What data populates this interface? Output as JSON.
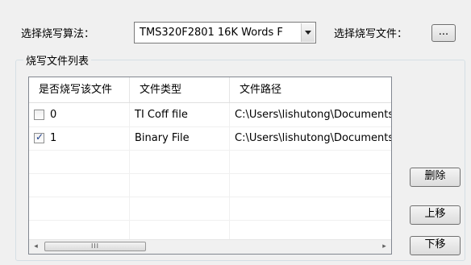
{
  "algorithm": {
    "label": "选择烧写算法：",
    "selected": "TMS320F2801 16K Words F"
  },
  "file_select": {
    "label": "选择烧写文件：",
    "browse_label": "..."
  },
  "group": {
    "title": "烧写文件列表"
  },
  "table": {
    "columns": [
      "是否烧写该文件",
      "文件类型",
      "文件路径"
    ],
    "rows": [
      {
        "checked": false,
        "index": "0",
        "type": "TI Coff file",
        "path": "C:\\Users\\lishutong\\Documents"
      },
      {
        "checked": true,
        "index": "1",
        "type": "Binary File",
        "path": "C:\\Users\\lishutong\\Documents"
      }
    ]
  },
  "scrollbar": {
    "left_arrow": "◂",
    "right_arrow": "▸",
    "thumb_grip": "III"
  },
  "buttons": {
    "delete": "删除",
    "move_up": "上移",
    "move_down": "下移"
  }
}
